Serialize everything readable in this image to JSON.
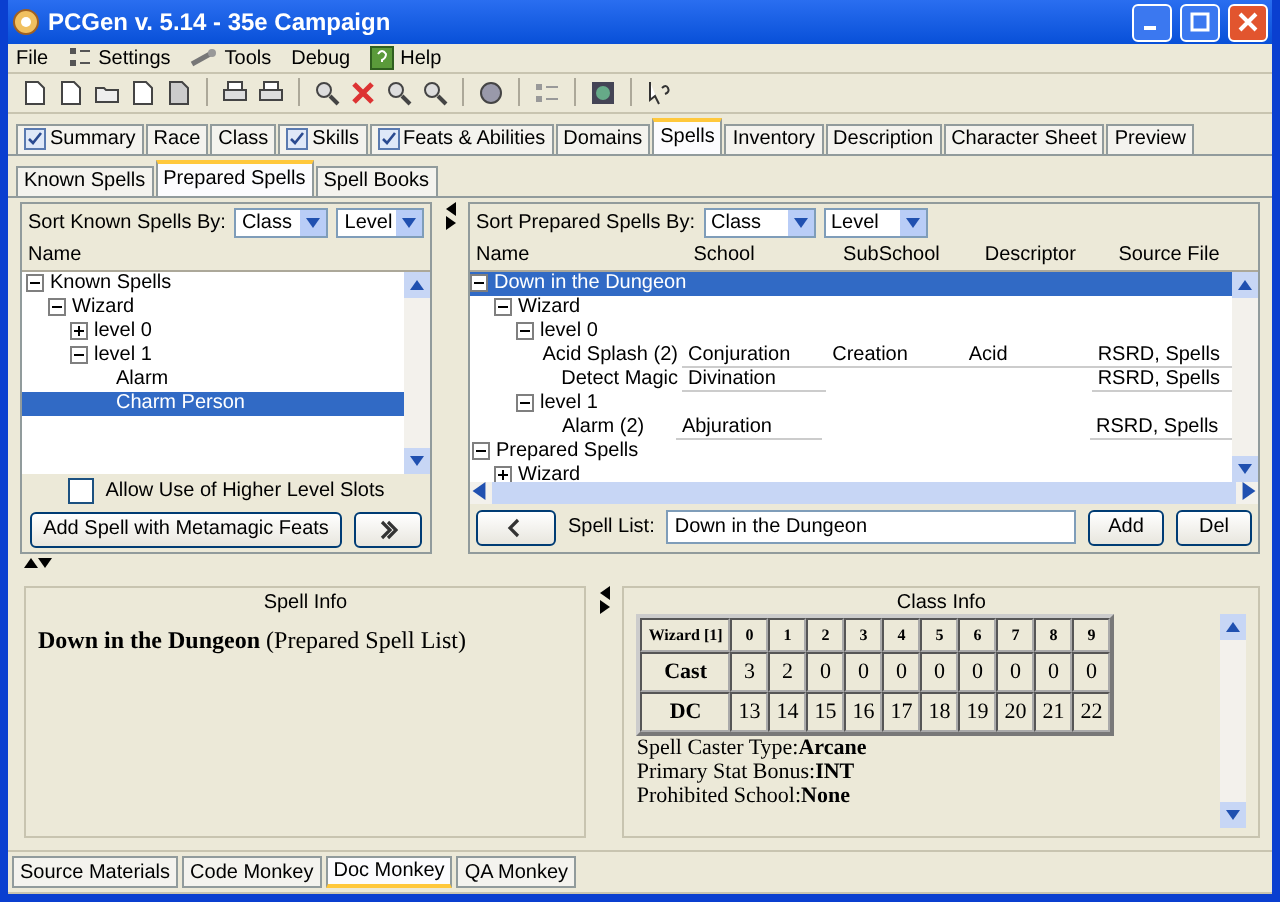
{
  "window": {
    "title": "PCGen v. 5.14 - 35e Campaign"
  },
  "menu": [
    {
      "label": "File",
      "kind": "plain"
    },
    {
      "label": "Settings",
      "kind": "settings"
    },
    {
      "label": "Tools",
      "kind": "tools"
    },
    {
      "label": "Debug",
      "kind": "plain"
    },
    {
      "label": "Help",
      "kind": "help"
    }
  ],
  "tabs": [
    {
      "label": "Summary",
      "selected": false,
      "complete": true
    },
    {
      "label": "Race",
      "selected": false,
      "complete": false
    },
    {
      "label": "Class",
      "selected": false,
      "complete": false
    },
    {
      "label": "Skills",
      "selected": false,
      "complete": true
    },
    {
      "label": "Feats & Abilities",
      "selected": false,
      "complete": true
    },
    {
      "label": "Domains",
      "selected": false,
      "complete": false
    },
    {
      "label": "Spells",
      "selected": true,
      "complete": false
    },
    {
      "label": "Inventory",
      "selected": false,
      "complete": false
    },
    {
      "label": "Description",
      "selected": false,
      "complete": false
    },
    {
      "label": "Character Sheet",
      "selected": false,
      "complete": false
    },
    {
      "label": "Preview",
      "selected": false,
      "complete": false
    }
  ],
  "sub_tabs": [
    {
      "label": "Known Spells",
      "selected": false
    },
    {
      "label": "Prepared Spells",
      "selected": true
    },
    {
      "label": "Spell Books",
      "selected": false
    }
  ],
  "known_panel": {
    "sort_label": "Sort Known Spells By:",
    "sort_by": "Class",
    "sort_then": "Level",
    "column": "Name",
    "tree": [
      {
        "label": "Known Spells",
        "expanded": true,
        "selected": false,
        "children": [
          {
            "label": "Wizard",
            "expanded": true,
            "selected": false,
            "children": [
              {
                "label": "level  0",
                "expanded": false,
                "selected": false
              },
              {
                "label": "level  1",
                "expanded": true,
                "selected": false,
                "children": [
                  {
                    "label": "Alarm",
                    "selected": false
                  },
                  {
                    "label": "Charm Person",
                    "selected": true
                  }
                ]
              }
            ]
          }
        ]
      }
    ],
    "checkbox": {
      "label": "Allow Use of Higher Level Slots",
      "checked": false
    },
    "metamagic_button": "Add Spell with Metamagic Feats"
  },
  "prepared_panel": {
    "sort_label": "Sort Prepared Spells By:",
    "sort_by": "Class",
    "sort_then": "Level",
    "columns": [
      "Name",
      "School",
      "SubSchool",
      "Descriptor",
      "Source File"
    ],
    "tree": [
      {
        "label": "Down in the Dungeon",
        "expanded": true,
        "selected": true,
        "children": [
          {
            "label": "Wizard",
            "expanded": true,
            "selected": false,
            "children": [
              {
                "label": "level  0",
                "expanded": true,
                "selected": false,
                "children": [
                  {
                    "label": "Acid Splash (2)",
                    "selected": false,
                    "cells": [
                      "Conjuration",
                      "Creation",
                      "Acid",
                      "RSRD, Spells"
                    ]
                  },
                  {
                    "label": "Detect Magic",
                    "selected": false,
                    "cells": [
                      "Divination",
                      "",
                      "",
                      "RSRD, Spells"
                    ]
                  }
                ]
              },
              {
                "label": "level  1",
                "expanded": true,
                "selected": false,
                "children": [
                  {
                    "label": "Alarm (2)",
                    "selected": false,
                    "cells": [
                      "Abjuration",
                      "",
                      "",
                      "RSRD, Spells"
                    ]
                  }
                ]
              }
            ]
          }
        ]
      },
      {
        "label": "Prepared Spells",
        "expanded": true,
        "selected": false,
        "children": [
          {
            "label": "Wizard",
            "expanded": false,
            "selected": false
          }
        ]
      }
    ],
    "spell_list_label": "Spell List:",
    "spell_list": "Down in the Dungeon",
    "buttons": [
      "Add",
      "Del"
    ]
  },
  "spell_info": {
    "title": "Spell Info",
    "text": "**Down in the Dungeon** (Prepared Spell List)"
  },
  "class_info": {
    "title": "Class Info",
    "header": [
      "Wizard [1]",
      "0",
      "1",
      "2",
      "3",
      "4",
      "5",
      "6",
      "7",
      "8",
      "9"
    ],
    "rows": [
      [
        "Cast",
        "3",
        "2",
        "0",
        "0",
        "0",
        "0",
        "0",
        "0",
        "0",
        "0"
      ],
      [
        "DC",
        "13",
        "14",
        "15",
        "16",
        "17",
        "18",
        "19",
        "20",
        "21",
        "22"
      ]
    ],
    "lines": [
      "Spell Caster Type:**Arcane**",
      "Primary Stat Bonus:**INT**",
      "Prohibited School:**None**"
    ]
  },
  "bottom_tabs": [
    {
      "label": "Source Materials",
      "selected": false
    },
    {
      "label": "Code Monkey",
      "selected": false
    },
    {
      "label": "Doc Monkey",
      "selected": true
    },
    {
      "label": "QA Monkey",
      "selected": false
    }
  ]
}
